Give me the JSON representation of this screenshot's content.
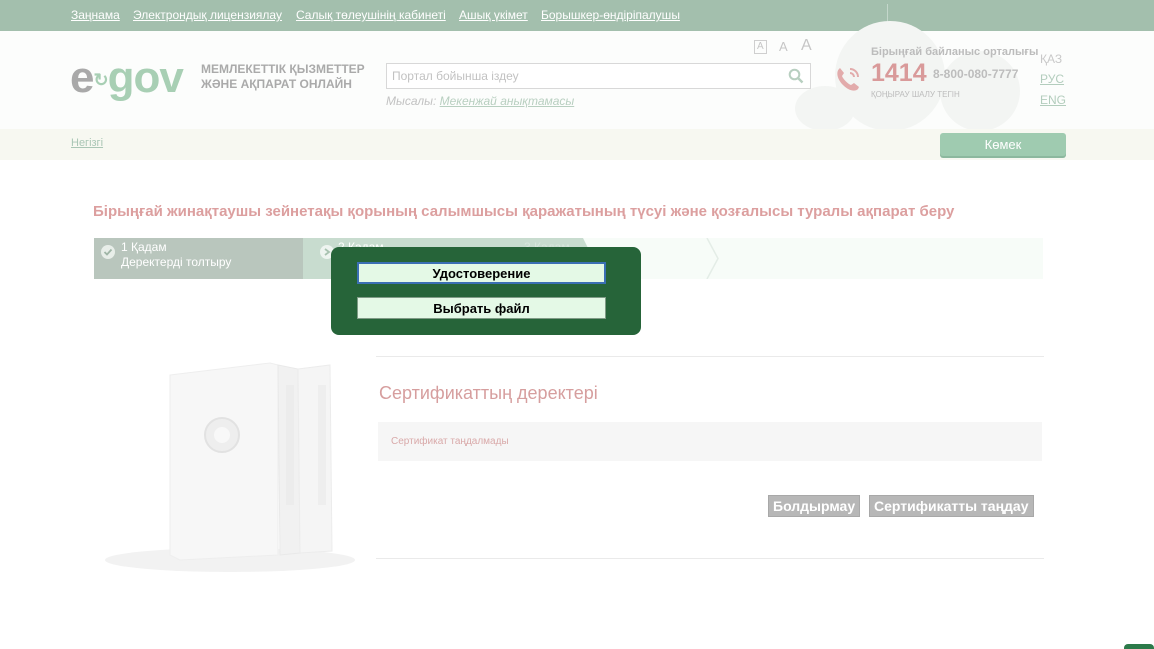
{
  "topnav": {
    "items": [
      "Заңнама",
      "Электрондық лицензиялау",
      "Салық төлеушінің кабинеті",
      "Ашық үкімет",
      "Борышкер-өндіріпалушы"
    ]
  },
  "header": {
    "logo_e": "e",
    "logo_arrow": "↻",
    "logo_gov": "gov",
    "tagline_line1": "МЕМЛЕКЕТТІК ҚЫЗМЕТТЕР",
    "tagline_line2": "ЖӘНЕ АҚПАРАТ ОНЛАЙН",
    "search_placeholder": "Портал бойынша іздеу",
    "search_icon": "search-icon",
    "example_label": "Мысалы:",
    "example_link": "Мекенжай анықтамасы",
    "font_sizes": [
      "A",
      "A",
      "A"
    ],
    "contact_title": "Бірыңғай байланыс орталығы",
    "phone_short": "1414",
    "phone_long": "8-800-080-7777",
    "phone_sub": "ҚОҢЫРАУ ШАЛУ ТЕГІН",
    "languages": [
      "ҚАЗ",
      "РУС",
      "ENG"
    ]
  },
  "breadcrumb": {
    "home": "Негізгі",
    "help_button": "Көмек"
  },
  "page": {
    "title": "Бірыңғай жинақтаушы зейнетақы қорының салымшысы қаражатының түсуі және қозғалысы туралы ақпарат беру"
  },
  "steps": [
    {
      "num": "1 Қадам",
      "label": "Деректерді толтыру"
    },
    {
      "num": "2 Қадам",
      "label": ""
    },
    {
      "num": "3 Қадам",
      "label": ""
    }
  ],
  "certificate": {
    "title": "Сертификаттың деректері",
    "status": "Сертификат таңдалмады",
    "cancel_button": "Болдырмау",
    "select_button": "Сертификатты таңдау"
  },
  "modal": {
    "option1": "Удостоверение",
    "option2": "Выбрать файл"
  },
  "colors": {
    "modal_bg": "#266439",
    "nav_bg": "#a3bfad",
    "title_pink": "#dc9f9f"
  }
}
